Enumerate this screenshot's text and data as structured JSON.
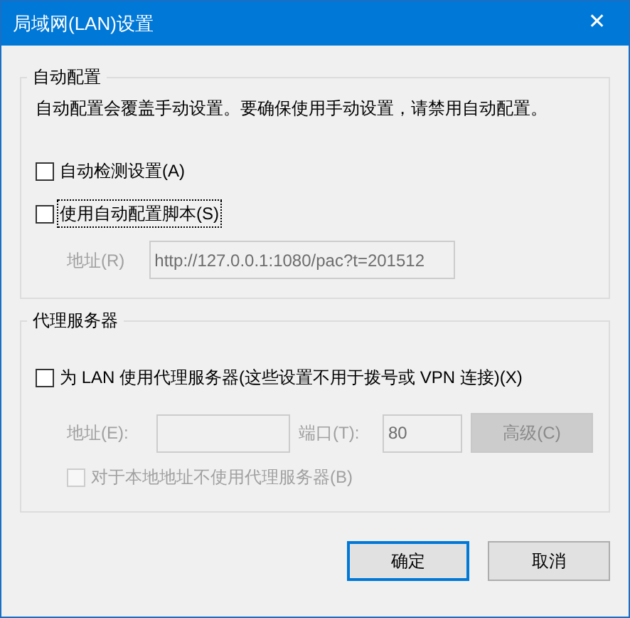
{
  "window": {
    "title": "局域网(LAN)设置",
    "close": "✕"
  },
  "auto_config": {
    "title": "自动配置",
    "description": "自动配置会覆盖手动设置。要确保使用手动设置，请禁用自动配置。",
    "options": [
      {
        "label": "自动检测设置(A)",
        "checked": false,
        "focused": false
      },
      {
        "label": "使用自动配置脚本(S)",
        "checked": false,
        "focused": true
      }
    ],
    "address": {
      "label": "地址(R)",
      "value": "http://127.0.0.1:1080/pac?t=201512",
      "disabled": true
    }
  },
  "proxy": {
    "title": "代理服务器",
    "use_proxy": {
      "label": "为 LAN 使用代理服务器(这些设置不用于拨号或 VPN 连接)(X)",
      "checked": false
    },
    "address": {
      "label": "地址(E):",
      "disabled": true
    },
    "port": {
      "label": "端口(T):",
      "value": "80",
      "disabled": true
    },
    "advanced": {
      "label": "高级(C)",
      "disabled": true
    },
    "bypass": {
      "label": "对于本地地址不使用代理服务器(B)",
      "checked": false,
      "disabled": true
    }
  },
  "buttons": [
    {
      "label": "确定",
      "default": true
    },
    {
      "label": "取消",
      "default": false
    }
  ]
}
